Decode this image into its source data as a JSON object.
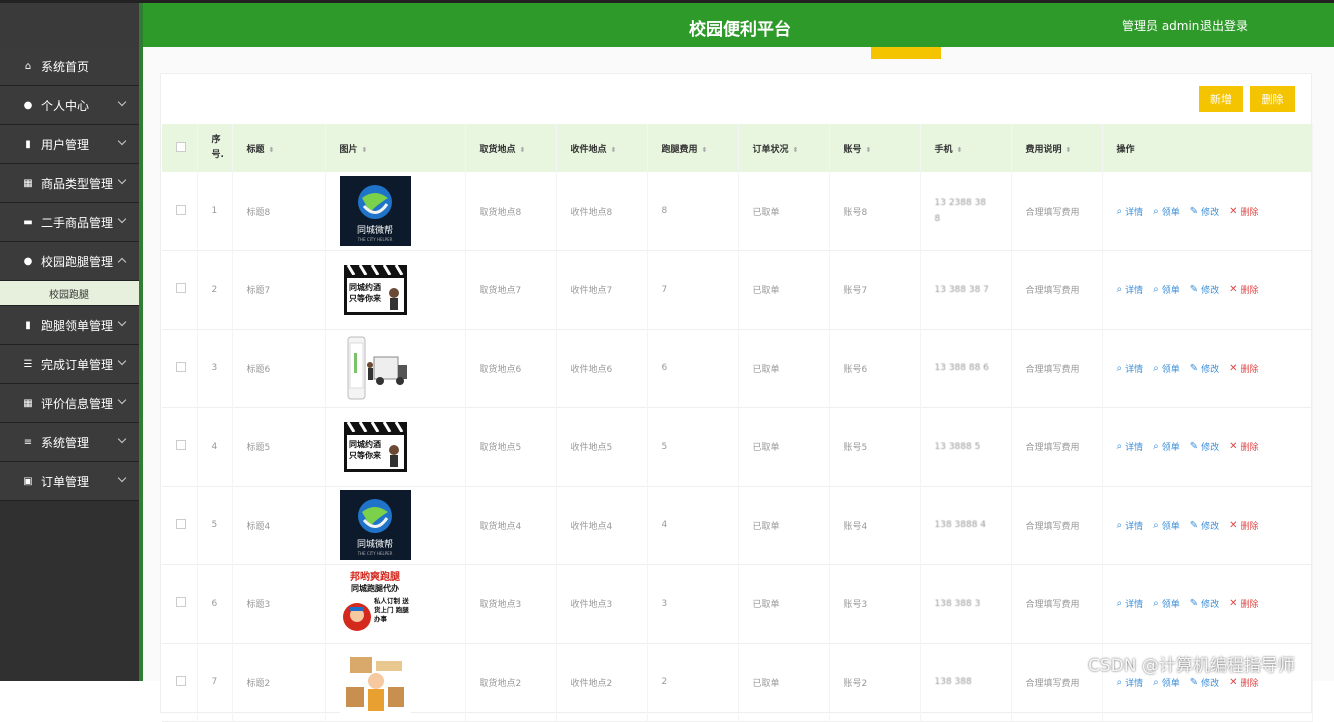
{
  "header": {
    "title": "校园便利平台",
    "user": "管理员 admin",
    "logout": "退出登录"
  },
  "sidebar": {
    "items": [
      {
        "label": "系统首页",
        "icon": "home-icon",
        "expand": false
      },
      {
        "label": "个人中心",
        "icon": "person-icon",
        "expand": true
      },
      {
        "label": "用户管理",
        "icon": "book-icon",
        "expand": true
      },
      {
        "label": "商品类型管理",
        "icon": "grid-icon",
        "expand": true
      },
      {
        "label": "二手商品管理",
        "icon": "briefcase-icon",
        "expand": true
      },
      {
        "label": "校园跑腿管理",
        "icon": "person-icon",
        "expand": true,
        "open": true
      },
      {
        "label": "跑腿领单管理",
        "icon": "book-icon",
        "expand": true
      },
      {
        "label": "完成订单管理",
        "icon": "sliders-icon",
        "expand": true
      },
      {
        "label": "评价信息管理",
        "icon": "grid-icon",
        "expand": true
      },
      {
        "label": "系统管理",
        "icon": "list-icon",
        "expand": true
      },
      {
        "label": "订单管理",
        "icon": "clipboard-icon",
        "expand": true
      }
    ],
    "submenu": "校园跑腿"
  },
  "toolbar": {
    "add": "新增",
    "delete": "删除"
  },
  "table": {
    "headers": [
      "序号.",
      "标题",
      "图片",
      "取货地点",
      "收件地点",
      "跑腿费用",
      "订单状况",
      "账号",
      "手机",
      "费用说明",
      "操作"
    ],
    "rows": [
      {
        "no": "1",
        "title": "标题8",
        "pickup": "取货地点8",
        "dest": "收件地点8",
        "fee": "8",
        "status": "已取单",
        "account": "账号8",
        "phone": "13 2388 38 8",
        "note": "合理填写费用",
        "img": "logo"
      },
      {
        "no": "2",
        "title": "标题7",
        "pickup": "取货地点7",
        "dest": "收件地点7",
        "fee": "7",
        "status": "已取单",
        "account": "账号7",
        "phone": "13 388 38 7",
        "note": "合理填写费用",
        "img": "clapper"
      },
      {
        "no": "3",
        "title": "标题6",
        "pickup": "取货地点6",
        "dest": "收件地点6",
        "fee": "6",
        "status": "已取单",
        "account": "账号6",
        "phone": "13 388 88 6",
        "note": "合理填写费用",
        "img": "truck"
      },
      {
        "no": "4",
        "title": "标题5",
        "pickup": "取货地点5",
        "dest": "收件地点5",
        "fee": "5",
        "status": "已取单",
        "account": "账号5",
        "phone": "13 3888 5",
        "note": "合理填写费用",
        "img": "clapper"
      },
      {
        "no": "5",
        "title": "标题4",
        "pickup": "取货地点4",
        "dest": "收件地点4",
        "fee": "4",
        "status": "已取单",
        "account": "账号4",
        "phone": "138 3888 4",
        "note": "合理填写费用",
        "img": "logo"
      },
      {
        "no": "6",
        "title": "标题3",
        "pickup": "取货地点3",
        "dest": "收件地点3",
        "fee": "3",
        "status": "已取单",
        "account": "账号3",
        "phone": "138 388 3",
        "note": "合理填写费用",
        "img": "poster"
      },
      {
        "no": "7",
        "title": "标题2",
        "pickup": "取货地点2",
        "dest": "收件地点2",
        "fee": "2",
        "status": "已取单",
        "account": "账号2",
        "phone": "138 388",
        "note": "合理填写费用",
        "img": "box"
      }
    ],
    "actions": {
      "detail": "详情",
      "take": "领单",
      "edit": "修改",
      "delete": "删除"
    }
  },
  "images": {
    "logo_text": "同城微帮",
    "logo_sub": "THE CITY HELPER",
    "clapper_text": "同城约酒 只等你来",
    "poster_title": "邦哟爽跑腿",
    "poster_sub": "同城跑腿代办",
    "poster_tags": "私人订制 送货上门 跑腿办事"
  },
  "watermark": "CSDN @计算机编程指导师"
}
